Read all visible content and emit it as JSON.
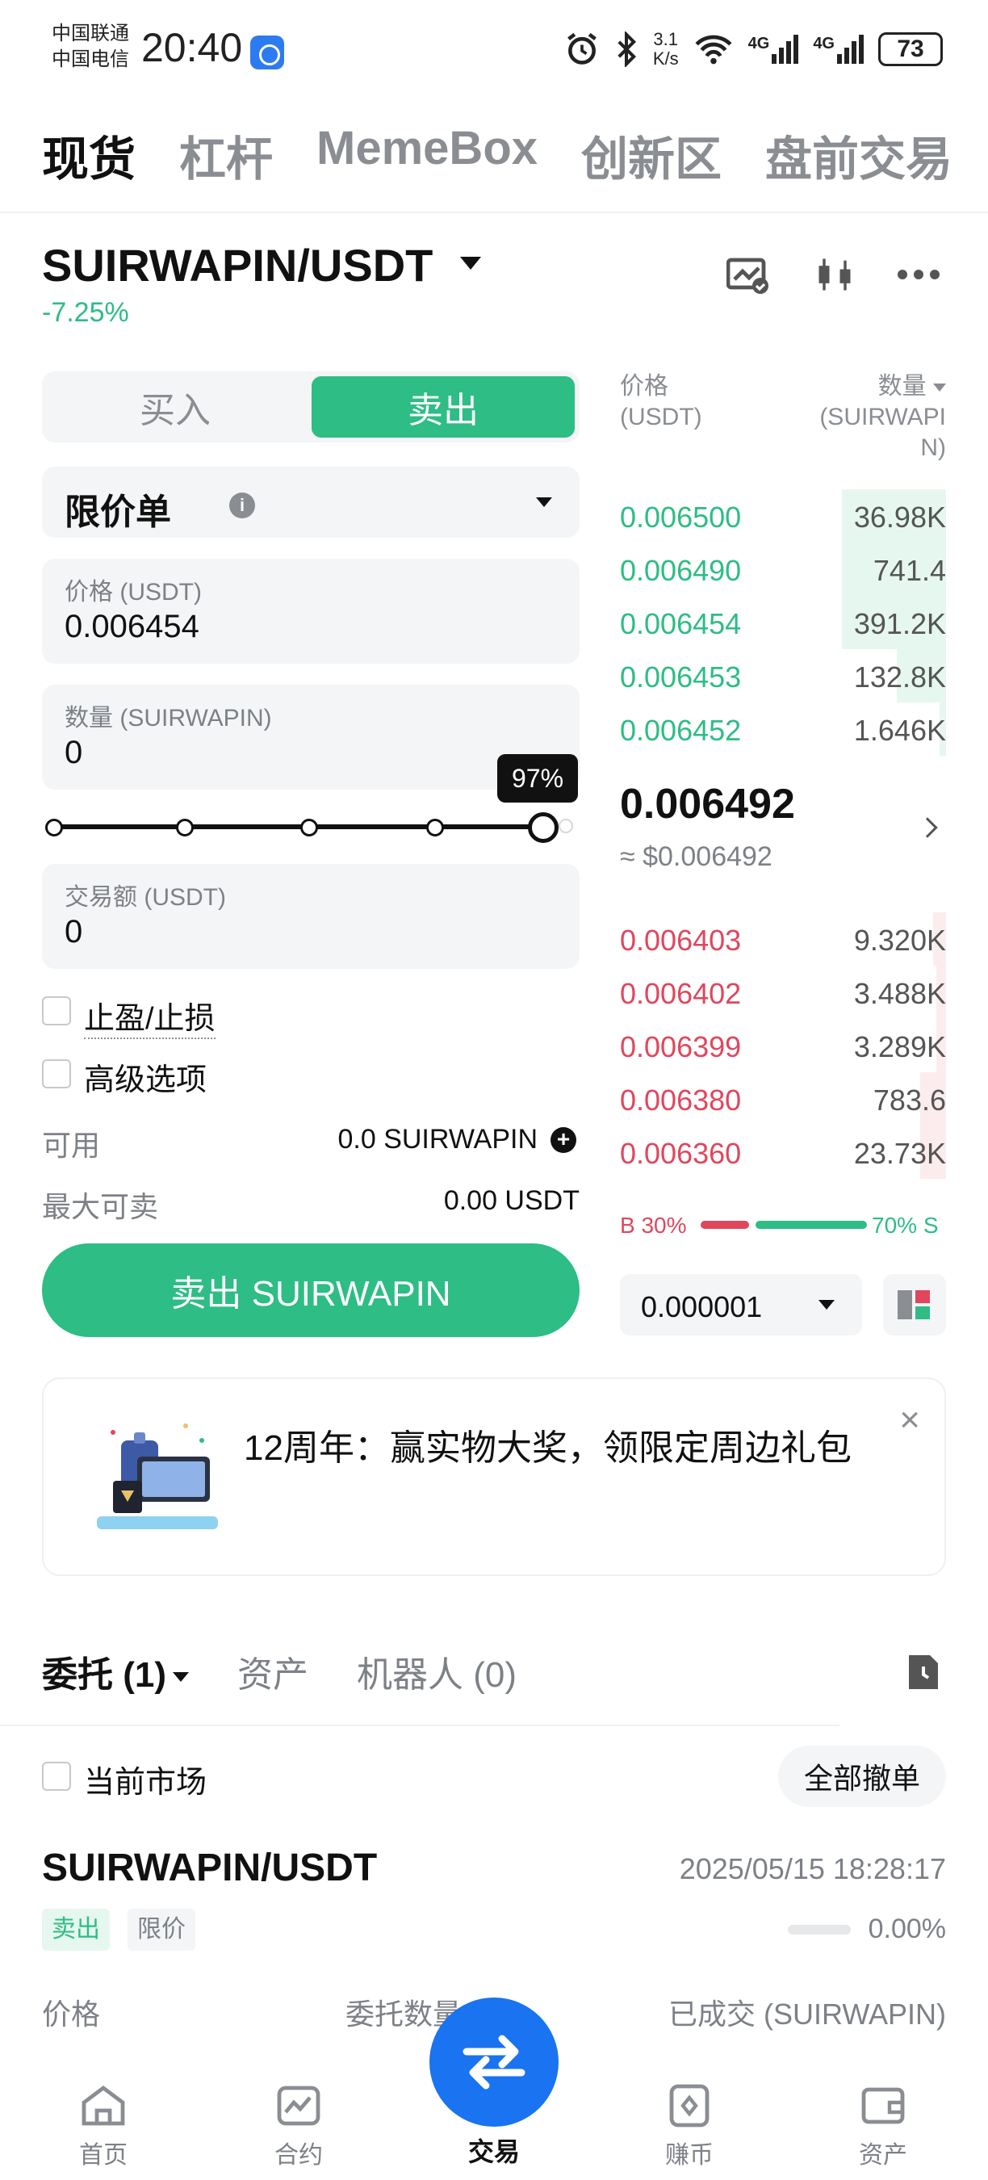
{
  "status_bar": {
    "carrier1": "中国联通",
    "carrier2": "中国电信",
    "time": "20:40",
    "net_speed_top": "3.1",
    "net_speed_bottom": "K/s",
    "signal1": "4G",
    "signal2": "4G",
    "battery": "73"
  },
  "top_tabs": [
    "现货",
    "杠杆",
    "MemeBox",
    "创新区",
    "盘前交易"
  ],
  "pair": {
    "title": "SUIRWAPIN/USDT",
    "change": "-7.25%"
  },
  "trade_form": {
    "buy_label": "买入",
    "sell_label": "卖出",
    "order_type": "限价单",
    "info_glyph": "i",
    "price_label": "价格 (USDT)",
    "price_value": "0.006454",
    "qty_label": "数量 (SUIRWAPIN)",
    "qty_value": "0",
    "slider_percent": "97%",
    "slider_fraction": 0.97,
    "amount_label": "交易额 (USDT)",
    "amount_value": "0",
    "tpsl_label": "止盈/止损",
    "advanced_label": "高级选项",
    "available_label": "可用",
    "available_value": "0.0 SUIRWAPIN",
    "max_sell_label": "最大可卖",
    "max_sell_value": "0.00 USDT",
    "submit_label": "卖出 SUIRWAPIN"
  },
  "order_book": {
    "price_head_1": "价格",
    "price_head_2": "(USDT)",
    "qty_head_1": "数量",
    "qty_head_2": "(SUIRWAPI",
    "qty_head_3": "N)",
    "asks": [
      {
        "price": "0.006500",
        "qty": "36.98K",
        "depth": 0.32
      },
      {
        "price": "0.006490",
        "qty": "741.4",
        "depth": 0.32
      },
      {
        "price": "0.006454",
        "qty": "391.2K",
        "depth": 0.32
      },
      {
        "price": "0.006453",
        "qty": "132.8K",
        "depth": 0.15
      },
      {
        "price": "0.006452",
        "qty": "1.646K",
        "depth": 0.02
      }
    ],
    "mid_price": "0.006492",
    "mid_usd": "≈ $0.006492",
    "bids": [
      {
        "price": "0.006403",
        "qty": "9.320K",
        "depth": 0.04
      },
      {
        "price": "0.006402",
        "qty": "3.488K",
        "depth": 0.03
      },
      {
        "price": "0.006399",
        "qty": "3.289K",
        "depth": 0.03
      },
      {
        "price": "0.006380",
        "qty": "783.6",
        "depth": 0.08
      },
      {
        "price": "0.006360",
        "qty": "23.73K",
        "depth": 0.08
      }
    ],
    "buy_ratio": "B 30%",
    "sell_ratio": "70% S",
    "precision": "0.000001"
  },
  "colors": {
    "green": "#2dbd85",
    "red": "#e0475d",
    "blue": "#1a73f0"
  },
  "banner": {
    "text": "12周年：赢实物大奖，领限定周边礼包",
    "close": "×"
  },
  "orders": {
    "tab_orders": "委托 (1)",
    "tab_assets": "资产",
    "tab_bots": "机器人 (0)",
    "current_market": "当前市场",
    "cancel_all": "全部撤单",
    "pair": "SUIRWAPIN/USDT",
    "time": "2025/05/15 18:28:17",
    "side_tag": "卖出",
    "type_tag": "限价",
    "filled_pct": "0.00%",
    "col_price": "价格",
    "col_qty": "委托数量",
    "col_filled": "已成交 (SUIRWAPIN)"
  },
  "bottom_nav": {
    "home": "首页",
    "futures": "合约",
    "trade": "交易",
    "earn": "赚币",
    "assets": "资产"
  }
}
